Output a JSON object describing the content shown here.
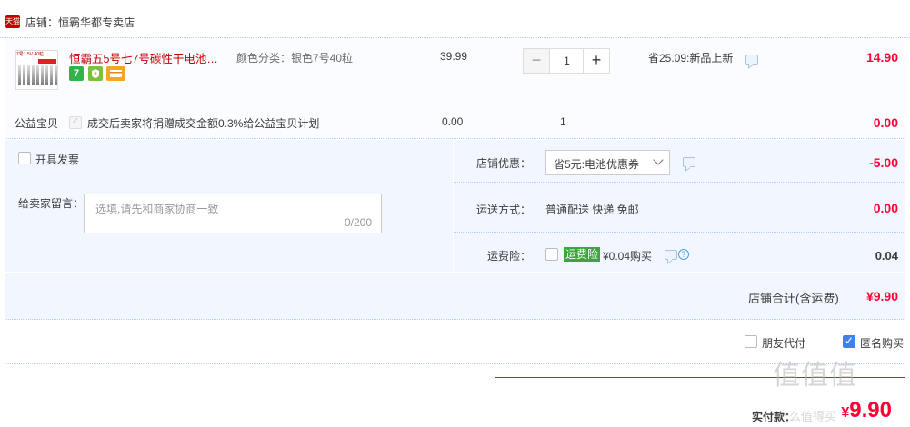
{
  "shop": {
    "badge": "天猫",
    "label": "店铺：恒霸华都专卖店"
  },
  "item": {
    "thumb_text": "7号1.5V 40粒",
    "title": "恒霸五5号七7号碳性干电池儿…",
    "service_icons": [
      "seven-day-return-icon",
      "guarantee-icon",
      "credit-card-icon"
    ],
    "sku": "颜色分类：银色7号40粒",
    "price": "39.99",
    "quantity": "1",
    "discount": "省25.09:新品上新",
    "amount": "14.90"
  },
  "charity": {
    "label": "公益宝贝",
    "desc": "成交后卖家将捐赠成交金额0.3%给公益宝贝计划",
    "price": "0.00",
    "quantity": "1",
    "amount": "0.00"
  },
  "invoice": {
    "label": "开具发票"
  },
  "memo": {
    "label": "给卖家留言：",
    "placeholder": "选填,请先和商家协商一致",
    "counter": "0/200"
  },
  "shop_discount": {
    "label": "店铺优惠：",
    "selected": "省5元:电池优惠券",
    "amount": "-5.00"
  },
  "shipping": {
    "label": "运送方式：",
    "method": "普通配送 快递 免邮",
    "amount": "0.00"
  },
  "insurance": {
    "label": "运费险：",
    "tag": "运费险",
    "desc": "¥0.04购买",
    "amount": "0.04"
  },
  "shop_total": {
    "label": "店铺合计(含运费)",
    "amount": "¥9.90"
  },
  "options": {
    "friend_pay": "朋友代付",
    "anonymous": "匿名购买"
  },
  "payment": {
    "label": "实付款：",
    "currency": "¥",
    "amount": "9.90"
  },
  "watermark": {
    "main": "值值值",
    "sub": "什么值得买"
  },
  "colors": {
    "accent": "#ff0036",
    "title_red": "#c40000",
    "panel": "#f2f7ff",
    "dotted": "#b2d1ff",
    "checkbox": "#3b82f6"
  }
}
